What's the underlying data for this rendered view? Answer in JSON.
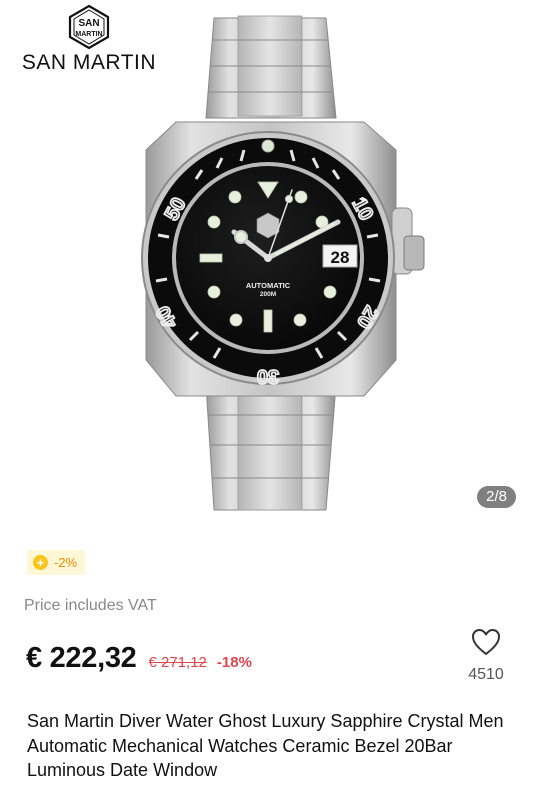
{
  "brand": {
    "name": "SAN MARTIN",
    "emblem_line1": "SAN",
    "emblem_line2": "MARTIN"
  },
  "gallery": {
    "counter": "2/8",
    "dial_text_line1": "AUTOMATIC",
    "dial_text_line2": "200M",
    "date": "28",
    "bezel_numbers": [
      "50",
      "10",
      "20",
      "30",
      "40"
    ]
  },
  "coupon": {
    "icon": "coin-icon",
    "text": "-2%"
  },
  "vat_note": "Price includes VAT",
  "pricing": {
    "price": "€ 222,32",
    "old_price": "€ 271,12",
    "discount": "-18%"
  },
  "wishlist": {
    "icon": "heart-icon",
    "count": "4510"
  },
  "product_title": "San Martin Diver Water Ghost Luxury Sapphire Crystal Men Automatic Mechanical Watches Ceramic Bezel 20Bar Luminous Date Window",
  "colors": {
    "accent_red": "#e0464e",
    "coupon_orange": "#f08c00",
    "coupon_bg": "#fff7d6"
  }
}
